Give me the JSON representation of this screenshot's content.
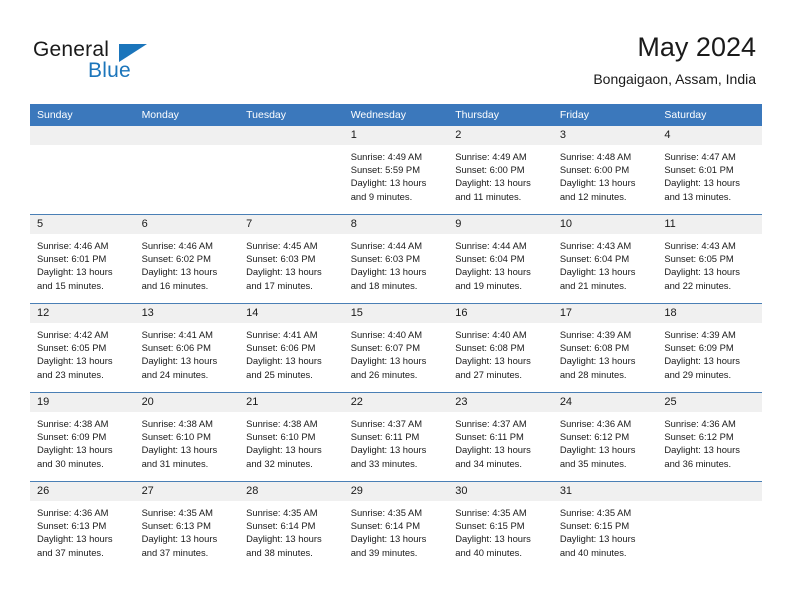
{
  "brand": {
    "name_primary": "General",
    "name_secondary": "Blue",
    "accent_color": "#1b75bb",
    "logo_icon": "triangle-icon"
  },
  "header": {
    "title": "May 2024",
    "subtitle": "Bongaigaon, Assam, India"
  },
  "theme": {
    "header_bar_color": "#3b78bc",
    "daynum_band_color": "#f0f0f0",
    "row_border_color": "#4a7fb5",
    "text_color": "#1a1a1a"
  },
  "labels": {
    "sunrise_prefix": "Sunrise:",
    "sunset_prefix": "Sunset:",
    "daylight_prefix": "Daylight:"
  },
  "weekday_headers": [
    "Sunday",
    "Monday",
    "Tuesday",
    "Wednesday",
    "Thursday",
    "Friday",
    "Saturday"
  ],
  "weeks": [
    [
      {
        "day": "",
        "sunrise": "",
        "sunset": "",
        "daylight": "",
        "empty": true
      },
      {
        "day": "",
        "sunrise": "",
        "sunset": "",
        "daylight": "",
        "empty": true
      },
      {
        "day": "",
        "sunrise": "",
        "sunset": "",
        "daylight": "",
        "empty": true
      },
      {
        "day": "1",
        "sunrise": "Sunrise: 4:49 AM",
        "sunset": "Sunset: 5:59 PM",
        "daylight": "Daylight: 13 hours and 9 minutes.",
        "empty": false
      },
      {
        "day": "2",
        "sunrise": "Sunrise: 4:49 AM",
        "sunset": "Sunset: 6:00 PM",
        "daylight": "Daylight: 13 hours and 11 minutes.",
        "empty": false
      },
      {
        "day": "3",
        "sunrise": "Sunrise: 4:48 AM",
        "sunset": "Sunset: 6:00 PM",
        "daylight": "Daylight: 13 hours and 12 minutes.",
        "empty": false
      },
      {
        "day": "4",
        "sunrise": "Sunrise: 4:47 AM",
        "sunset": "Sunset: 6:01 PM",
        "daylight": "Daylight: 13 hours and 13 minutes.",
        "empty": false
      }
    ],
    [
      {
        "day": "5",
        "sunrise": "Sunrise: 4:46 AM",
        "sunset": "Sunset: 6:01 PM",
        "daylight": "Daylight: 13 hours and 15 minutes.",
        "empty": false
      },
      {
        "day": "6",
        "sunrise": "Sunrise: 4:46 AM",
        "sunset": "Sunset: 6:02 PM",
        "daylight": "Daylight: 13 hours and 16 minutes.",
        "empty": false
      },
      {
        "day": "7",
        "sunrise": "Sunrise: 4:45 AM",
        "sunset": "Sunset: 6:03 PM",
        "daylight": "Daylight: 13 hours and 17 minutes.",
        "empty": false
      },
      {
        "day": "8",
        "sunrise": "Sunrise: 4:44 AM",
        "sunset": "Sunset: 6:03 PM",
        "daylight": "Daylight: 13 hours and 18 minutes.",
        "empty": false
      },
      {
        "day": "9",
        "sunrise": "Sunrise: 4:44 AM",
        "sunset": "Sunset: 6:04 PM",
        "daylight": "Daylight: 13 hours and 19 minutes.",
        "empty": false
      },
      {
        "day": "10",
        "sunrise": "Sunrise: 4:43 AM",
        "sunset": "Sunset: 6:04 PM",
        "daylight": "Daylight: 13 hours and 21 minutes.",
        "empty": false
      },
      {
        "day": "11",
        "sunrise": "Sunrise: 4:43 AM",
        "sunset": "Sunset: 6:05 PM",
        "daylight": "Daylight: 13 hours and 22 minutes.",
        "empty": false
      }
    ],
    [
      {
        "day": "12",
        "sunrise": "Sunrise: 4:42 AM",
        "sunset": "Sunset: 6:05 PM",
        "daylight": "Daylight: 13 hours and 23 minutes.",
        "empty": false
      },
      {
        "day": "13",
        "sunrise": "Sunrise: 4:41 AM",
        "sunset": "Sunset: 6:06 PM",
        "daylight": "Daylight: 13 hours and 24 minutes.",
        "empty": false
      },
      {
        "day": "14",
        "sunrise": "Sunrise: 4:41 AM",
        "sunset": "Sunset: 6:06 PM",
        "daylight": "Daylight: 13 hours and 25 minutes.",
        "empty": false
      },
      {
        "day": "15",
        "sunrise": "Sunrise: 4:40 AM",
        "sunset": "Sunset: 6:07 PM",
        "daylight": "Daylight: 13 hours and 26 minutes.",
        "empty": false
      },
      {
        "day": "16",
        "sunrise": "Sunrise: 4:40 AM",
        "sunset": "Sunset: 6:08 PM",
        "daylight": "Daylight: 13 hours and 27 minutes.",
        "empty": false
      },
      {
        "day": "17",
        "sunrise": "Sunrise: 4:39 AM",
        "sunset": "Sunset: 6:08 PM",
        "daylight": "Daylight: 13 hours and 28 minutes.",
        "empty": false
      },
      {
        "day": "18",
        "sunrise": "Sunrise: 4:39 AM",
        "sunset": "Sunset: 6:09 PM",
        "daylight": "Daylight: 13 hours and 29 minutes.",
        "empty": false
      }
    ],
    [
      {
        "day": "19",
        "sunrise": "Sunrise: 4:38 AM",
        "sunset": "Sunset: 6:09 PM",
        "daylight": "Daylight: 13 hours and 30 minutes.",
        "empty": false
      },
      {
        "day": "20",
        "sunrise": "Sunrise: 4:38 AM",
        "sunset": "Sunset: 6:10 PM",
        "daylight": "Daylight: 13 hours and 31 minutes.",
        "empty": false
      },
      {
        "day": "21",
        "sunrise": "Sunrise: 4:38 AM",
        "sunset": "Sunset: 6:10 PM",
        "daylight": "Daylight: 13 hours and 32 minutes.",
        "empty": false
      },
      {
        "day": "22",
        "sunrise": "Sunrise: 4:37 AM",
        "sunset": "Sunset: 6:11 PM",
        "daylight": "Daylight: 13 hours and 33 minutes.",
        "empty": false
      },
      {
        "day": "23",
        "sunrise": "Sunrise: 4:37 AM",
        "sunset": "Sunset: 6:11 PM",
        "daylight": "Daylight: 13 hours and 34 minutes.",
        "empty": false
      },
      {
        "day": "24",
        "sunrise": "Sunrise: 4:36 AM",
        "sunset": "Sunset: 6:12 PM",
        "daylight": "Daylight: 13 hours and 35 minutes.",
        "empty": false
      },
      {
        "day": "25",
        "sunrise": "Sunrise: 4:36 AM",
        "sunset": "Sunset: 6:12 PM",
        "daylight": "Daylight: 13 hours and 36 minutes.",
        "empty": false
      }
    ],
    [
      {
        "day": "26",
        "sunrise": "Sunrise: 4:36 AM",
        "sunset": "Sunset: 6:13 PM",
        "daylight": "Daylight: 13 hours and 37 minutes.",
        "empty": false
      },
      {
        "day": "27",
        "sunrise": "Sunrise: 4:35 AM",
        "sunset": "Sunset: 6:13 PM",
        "daylight": "Daylight: 13 hours and 37 minutes.",
        "empty": false
      },
      {
        "day": "28",
        "sunrise": "Sunrise: 4:35 AM",
        "sunset": "Sunset: 6:14 PM",
        "daylight": "Daylight: 13 hours and 38 minutes.",
        "empty": false
      },
      {
        "day": "29",
        "sunrise": "Sunrise: 4:35 AM",
        "sunset": "Sunset: 6:14 PM",
        "daylight": "Daylight: 13 hours and 39 minutes.",
        "empty": false
      },
      {
        "day": "30",
        "sunrise": "Sunrise: 4:35 AM",
        "sunset": "Sunset: 6:15 PM",
        "daylight": "Daylight: 13 hours and 40 minutes.",
        "empty": false
      },
      {
        "day": "31",
        "sunrise": "Sunrise: 4:35 AM",
        "sunset": "Sunset: 6:15 PM",
        "daylight": "Daylight: 13 hours and 40 minutes.",
        "empty": false
      },
      {
        "day": "",
        "sunrise": "",
        "sunset": "",
        "daylight": "",
        "empty": true
      }
    ]
  ]
}
